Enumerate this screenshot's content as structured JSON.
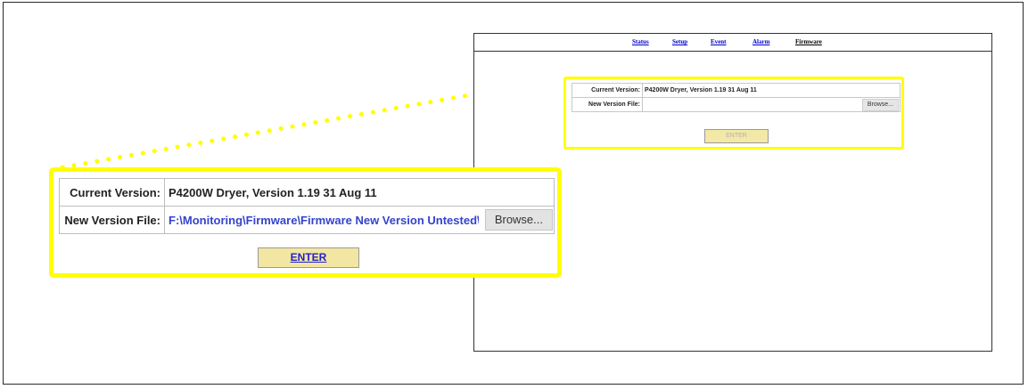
{
  "nav": {
    "items": [
      {
        "label": "Status",
        "active": false
      },
      {
        "label": "Setup",
        "active": false
      },
      {
        "label": "Event",
        "active": false
      },
      {
        "label": "Alarm",
        "active": false
      },
      {
        "label": "Firmware",
        "active": true
      }
    ]
  },
  "firmware_form": {
    "current_version_label": "Current Version:",
    "current_version_value": "P4200W Dryer, Version 1.19 31 Aug 11",
    "new_file_label": "New Version File:",
    "new_file_value": "F:\\Monitoring\\Firmware\\Firmware New Version Untested\\F",
    "browse_label": "Browse...",
    "enter_label": "ENTER"
  },
  "colors": {
    "highlight": "#ffff00",
    "link": "#0000cc",
    "button_bg": "#f2e6a2"
  }
}
